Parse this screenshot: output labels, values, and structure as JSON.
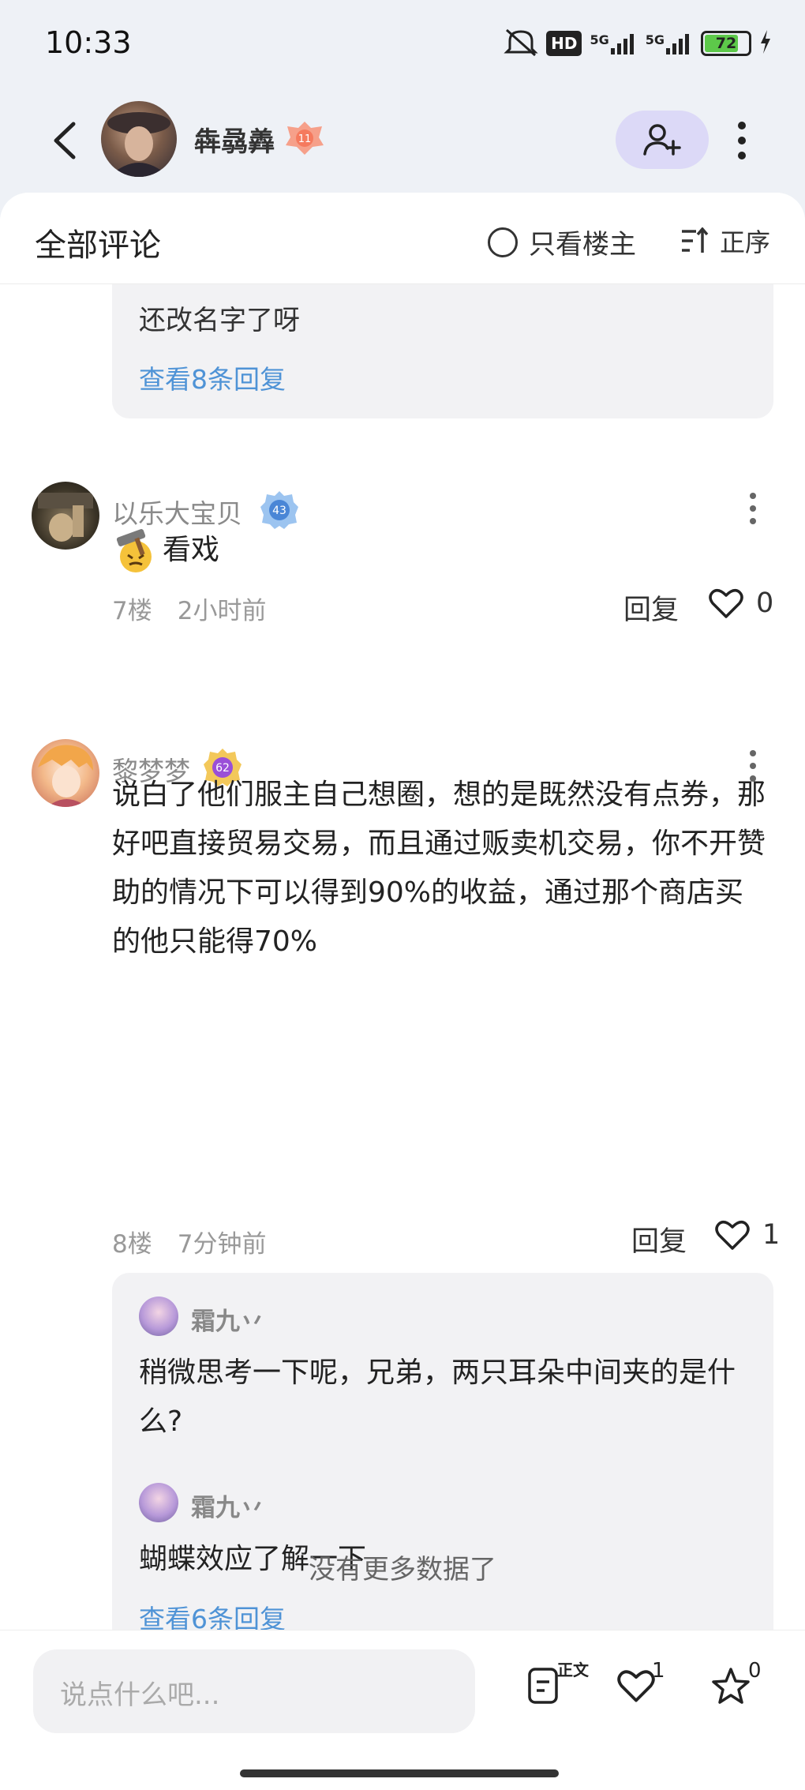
{
  "status_bar": {
    "time": "10:33",
    "network_badge": "HD",
    "signal_1": "5G",
    "signal_2": "5G",
    "battery": "72",
    "icons": [
      "mute-icon",
      "hd-icon",
      "signal-5g-icon",
      "signal-5g-icon",
      "battery-icon",
      "charging-icon"
    ]
  },
  "header": {
    "owner_name": "犇骉羴",
    "owner_level": "11",
    "icons": [
      "back-arrow-icon",
      "add-user-icon",
      "more-vertical-icon"
    ]
  },
  "panel": {
    "title": "全部评论",
    "only_owner_label": "只看楼主",
    "sort_label": "正序"
  },
  "top_reply_box": {
    "text": "还改名字了呀",
    "link": "查看8条回复"
  },
  "comments": [
    {
      "name": "以乐大宝贝",
      "level": "43",
      "body": "看戏",
      "emoji_icon": "hammer-face-emoji",
      "floor": "7楼",
      "time": "2小时前",
      "reply_label": "回复",
      "likes": "0"
    },
    {
      "name": "黎梦梦",
      "level": "62",
      "body": "说白了他们服主自己想圈，想的是既然没有点券，那好吧直接贸易交易，而且通过贩卖机交易，你不开赞助的情况下可以得到90%的收益，通过那个商店买的他只能得70%",
      "floor": "8楼",
      "time": "7分钟前",
      "reply_label": "回复",
      "likes": "1",
      "replies": [
        {
          "name": "霜九丷",
          "text": "稍微思考一下呢，兄弟，两只耳朵中间夹的是什么?"
        },
        {
          "name": "霜九丷",
          "text": "蝴蝶效应了解一下"
        }
      ],
      "replies_link": "查看6条回复"
    }
  ],
  "no_more": "没有更多数据了",
  "bottom_bar": {
    "input_placeholder": "说点什么吧...",
    "doc_label": "正文",
    "like_count": "1",
    "star_count": "0"
  },
  "colors": {
    "link": "#4f93d6",
    "follow_bg": "#dcd9f7",
    "page_bg": "#eef1f6"
  }
}
